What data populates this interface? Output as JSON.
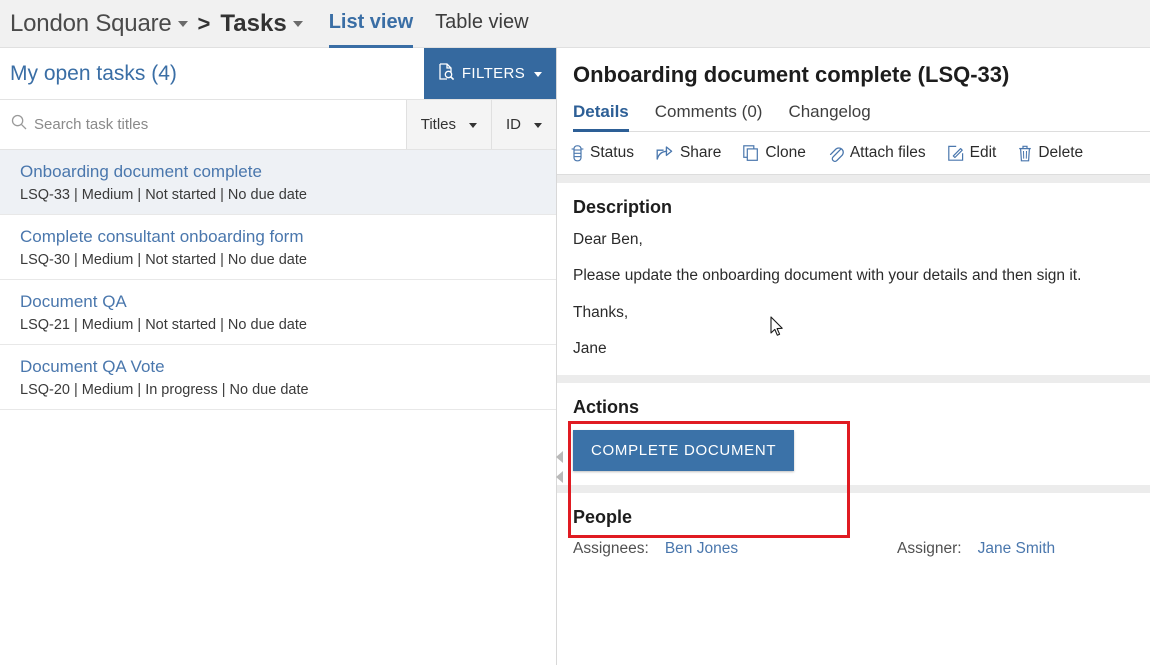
{
  "topbar": {
    "project": "London Square",
    "separator": ">",
    "section": "Tasks",
    "views": [
      {
        "label": "List view",
        "active": true
      },
      {
        "label": "Table view",
        "active": false
      }
    ]
  },
  "left_panel": {
    "title": "My open tasks (4)",
    "filters_button": "FILTERS",
    "search": {
      "placeholder": "Search task titles",
      "value": ""
    },
    "sort_selects": [
      {
        "label": "Titles"
      },
      {
        "label": "ID"
      }
    ],
    "tasks": [
      {
        "title": "Onboarding document complete",
        "meta": "LSQ-33 | Medium | Not started | No due date",
        "id": "LSQ-33",
        "priority": "Medium",
        "status": "Not started",
        "due": "No due date",
        "selected": true
      },
      {
        "title": "Complete consultant onboarding form",
        "meta": "LSQ-30 | Medium | Not started | No due date",
        "id": "LSQ-30",
        "priority": "Medium",
        "status": "Not started",
        "due": "No due date",
        "selected": false
      },
      {
        "title": "Document QA",
        "meta": "LSQ-21 | Medium | Not started | No due date",
        "id": "LSQ-21",
        "priority": "Medium",
        "status": "Not started",
        "due": "No due date",
        "selected": false
      },
      {
        "title": "Document QA Vote",
        "meta": "LSQ-20 | Medium | In progress | No due date",
        "id": "LSQ-20",
        "priority": "Medium",
        "status": "In progress",
        "due": "No due date",
        "selected": false
      }
    ]
  },
  "detail": {
    "title": "Onboarding document complete (LSQ-33)",
    "tabs": [
      {
        "label": "Details",
        "active": true
      },
      {
        "label": "Comments (0)",
        "active": false
      },
      {
        "label": "Changelog",
        "active": false
      }
    ],
    "actions_toolbar": [
      {
        "label": "Status",
        "icon": "traffic-light-icon"
      },
      {
        "label": "Share",
        "icon": "share-arrow-icon"
      },
      {
        "label": "Clone",
        "icon": "copy-icon"
      },
      {
        "label": "Attach files",
        "icon": "paperclip-icon"
      },
      {
        "label": "Edit",
        "icon": "pencil-square-icon"
      },
      {
        "label": "Delete",
        "icon": "trash-icon"
      }
    ],
    "description": {
      "heading": "Description",
      "lines": [
        "Dear Ben,",
        "Please update the onboarding document with your details and then sign it.",
        "Thanks,",
        "Jane"
      ]
    },
    "actions": {
      "heading": "Actions",
      "primary_button": "COMPLETE DOCUMENT"
    },
    "people": {
      "heading": "People",
      "assignees_label": "Assignees:",
      "assignees_value": "Ben Jones",
      "assigner_label": "Assigner:",
      "assigner_value": "Jane Smith"
    }
  },
  "annotation": {
    "highlight_color": "#e01b22"
  }
}
